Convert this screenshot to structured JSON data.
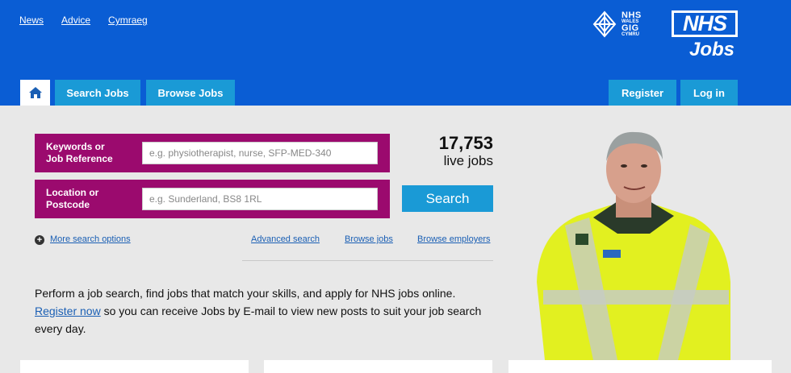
{
  "topnav": {
    "links": [
      "News",
      "Advice",
      "Cymraeg"
    ]
  },
  "brand": {
    "gig_lines": [
      "NHS",
      "WALES",
      "GIG",
      "CYMRU"
    ],
    "nhs": "NHS",
    "jobs": "Jobs"
  },
  "tabs": {
    "home_icon": "home-icon",
    "search": "Search Jobs",
    "browse": "Browse Jobs",
    "register": "Register",
    "login": "Log in"
  },
  "search": {
    "keywords_label_1": "Keywords or",
    "keywords_label_2": "Job Reference",
    "keywords_placeholder": "e.g. physiotherapist, nurse, SFP-MED-340",
    "location_label_1": "Location or",
    "location_label_2": "Postcode",
    "location_placeholder": "e.g. Sunderland, BS8 1RL",
    "button": "Search"
  },
  "stats": {
    "count": "17,753",
    "label": "live jobs"
  },
  "links": {
    "more": "More search options",
    "advanced": "Advanced search",
    "browse_jobs": "Browse jobs",
    "browse_employers": "Browse employers"
  },
  "intro": {
    "line1": "Perform a job search, find jobs that match your skills, and apply for NHS jobs online.",
    "register_link": "Register now",
    "line2": " so you can receive Jobs by E-mail to view new posts to suit your job search every day."
  },
  "colors": {
    "header": "#0a5dd4",
    "tab": "#1a9ad6",
    "search_row": "#9b0a6e"
  }
}
